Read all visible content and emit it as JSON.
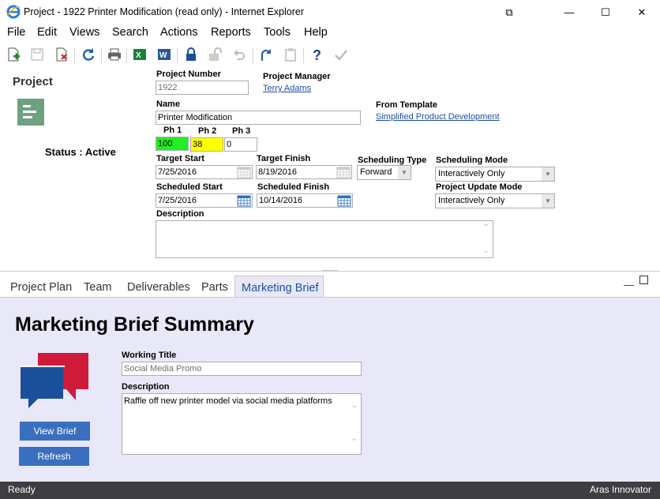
{
  "window": {
    "title": "Project - 1922 Printer Modification (read only) - Internet Explorer",
    "controls": [
      "⧉",
      "—",
      "☐",
      "✕"
    ]
  },
  "menu": [
    "File",
    "Edit",
    "Views",
    "Search",
    "Actions",
    "Reports",
    "Tools",
    "Help"
  ],
  "left": {
    "heading": "Project",
    "status_label": "Status : ",
    "status_value": "Active"
  },
  "form": {
    "project_number": {
      "label": "Project Number",
      "value": "1922"
    },
    "project_manager": {
      "label": "Project Manager",
      "value": "Terry Adams"
    },
    "name": {
      "label": "Name",
      "value": "Printer Modification"
    },
    "from_template": {
      "label": "From Template",
      "value": "Simplified Product Development"
    },
    "phases": [
      {
        "label": "Ph 1",
        "value": "100",
        "color": "#22ee22"
      },
      {
        "label": "Ph 2",
        "value": "38",
        "color": "#ffff00"
      },
      {
        "label": "Ph 3",
        "value": "0",
        "color": "#ffffff"
      }
    ],
    "target_start": {
      "label": "Target Start",
      "value": "7/25/2016"
    },
    "target_finish": {
      "label": "Target Finish",
      "value": "8/19/2016"
    },
    "scheduling_type": {
      "label": "Scheduling Type",
      "value": "Forward"
    },
    "scheduling_mode": {
      "label": "Scheduling Mode",
      "value": "Interactively Only"
    },
    "scheduled_start": {
      "label": "Scheduled Start",
      "value": "7/25/2016"
    },
    "scheduled_finish": {
      "label": "Scheduled Finish",
      "value": "10/14/2016"
    },
    "project_update_mode": {
      "label": "Project Update Mode",
      "value": "Interactively Only"
    },
    "description": {
      "label": "Description",
      "value": ""
    }
  },
  "tabs": [
    "Project Plan",
    "Team",
    "Deliverables",
    "Parts",
    "Marketing Brief"
  ],
  "brief": {
    "heading": "Marketing Brief Summary",
    "working_title": {
      "label": "Working Title",
      "value": "Social Media Promo"
    },
    "description": {
      "label": "Description",
      "value": "Raffle off new printer model via social media platforms"
    },
    "view_button": "View Brief",
    "refresh_button": "Refresh"
  },
  "status": {
    "left": "Ready",
    "right": "Aras Innovator"
  },
  "colors": {
    "accent": "#3a6fc0",
    "panel": "#e8e8f8",
    "statusbar": "#3e3e42",
    "link": "#1e4fa8"
  }
}
